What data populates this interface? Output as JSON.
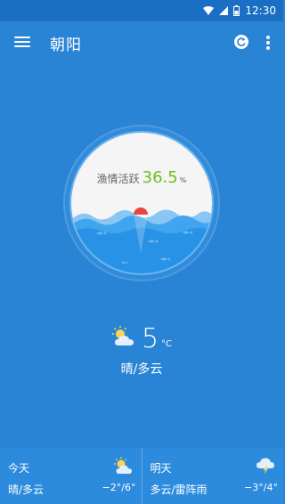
{
  "status_bar": {
    "time": "12:30"
  },
  "app_bar": {
    "title": "朝阳"
  },
  "gauge": {
    "label": "渔情活跃",
    "value": "36.5",
    "unit": "%"
  },
  "current": {
    "temperature": "5",
    "unit": "°C",
    "condition": "晴/多云",
    "icon": "partly-sunny-icon"
  },
  "forecast": [
    {
      "day": "今天",
      "condition": "晴/多云",
      "range": "−2°/6°",
      "icon": "partly-sunny-icon"
    },
    {
      "day": "明天",
      "condition": "多云/雷阵雨",
      "range": "−3°/4°",
      "icon": "thunderstorm-icon"
    }
  ]
}
